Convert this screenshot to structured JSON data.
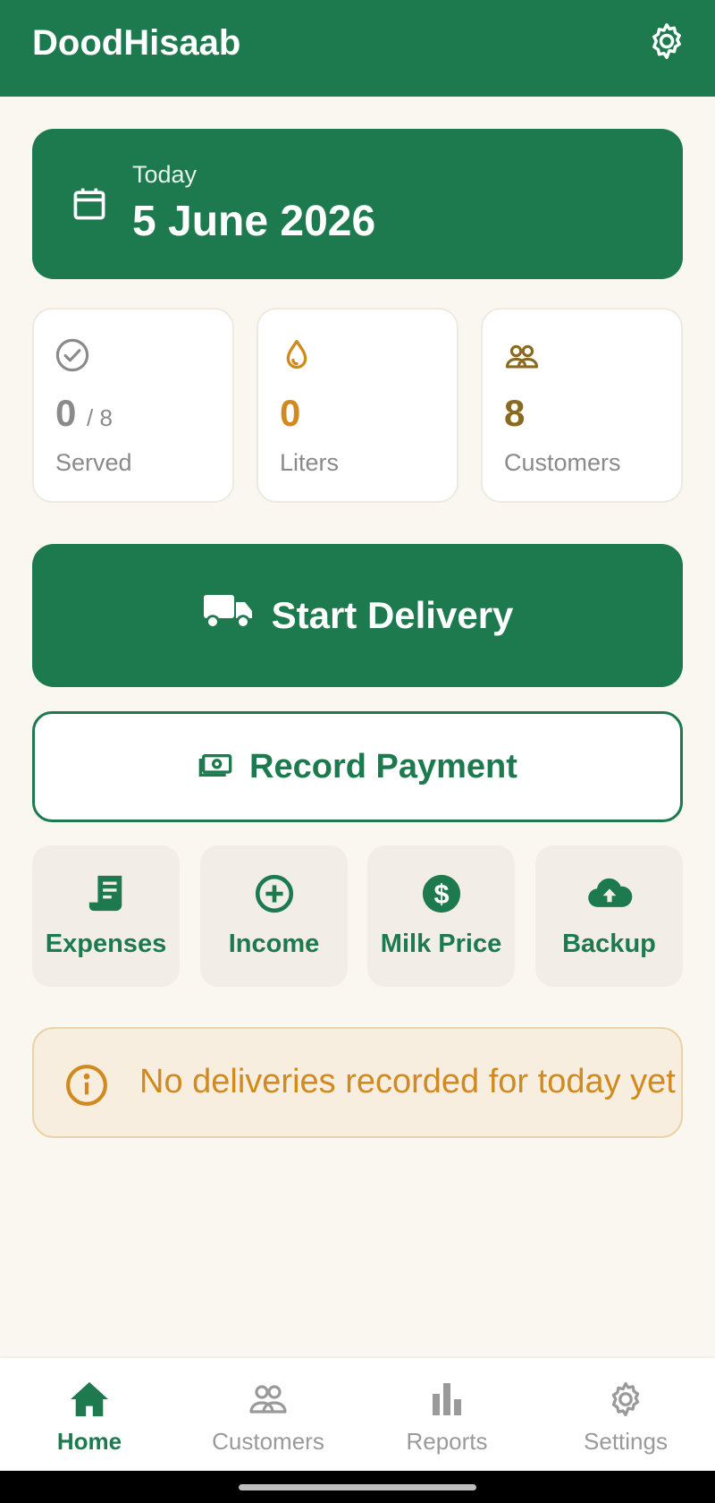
{
  "app": {
    "title": "DoodHisaab"
  },
  "icons": {
    "settings": "gear-icon",
    "calendar": "calendar-icon",
    "served": "check-circle-icon",
    "liters": "droplet-icon",
    "customers": "people-icon",
    "truck": "truck-icon",
    "payment": "cash-icon",
    "expenses": "receipt-icon",
    "income": "plus-circle-icon",
    "milk_price": "dollar-circle-icon",
    "backup": "cloud-upload-icon",
    "info": "info-icon"
  },
  "colors": {
    "primary": "#1D7A4E",
    "accent_gold": "#D08A1F",
    "accent_brown": "#8A6A1F",
    "background": "#FAF6F0"
  },
  "date_card": {
    "label": "Today",
    "date": "5 June 2026"
  },
  "stats": [
    {
      "value": "0",
      "sub": "/ 8",
      "caption": "Served",
      "color": "#8A8A8A"
    },
    {
      "value": "0",
      "sub": "",
      "caption": "Liters",
      "color": "#D08A1F"
    },
    {
      "value": "8",
      "sub": "",
      "caption": "Customers",
      "color": "#8A6A1F"
    }
  ],
  "actions": {
    "start_delivery": "Start Delivery",
    "record_payment": "Record Payment"
  },
  "tiles": [
    {
      "label": "Expenses"
    },
    {
      "label": "Income"
    },
    {
      "label": "Milk Price"
    },
    {
      "label": "Backup"
    }
  ],
  "notice": {
    "message": "No deliveries recorded for today yet"
  },
  "nav": {
    "active": "Home",
    "items": [
      {
        "label": "Home"
      },
      {
        "label": "Customers"
      },
      {
        "label": "Reports"
      },
      {
        "label": "Settings"
      }
    ]
  }
}
